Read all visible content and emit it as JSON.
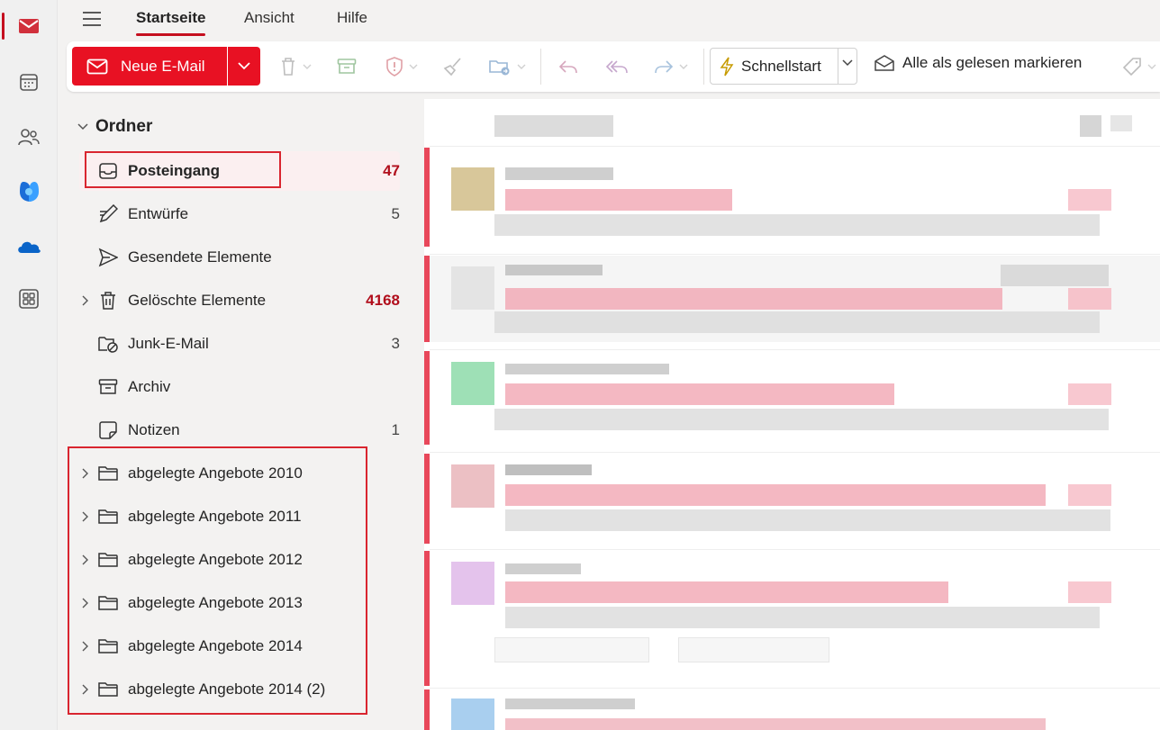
{
  "rail": {
    "items": [
      {
        "name": "mail-icon",
        "active": true
      },
      {
        "name": "calendar-icon",
        "active": false
      },
      {
        "name": "people-icon",
        "active": false
      },
      {
        "name": "copilot-icon",
        "active": false
      },
      {
        "name": "onedrive-icon",
        "active": false
      },
      {
        "name": "apps-icon",
        "active": false
      }
    ]
  },
  "menu": {
    "tabs": [
      "Startseite",
      "Ansicht",
      "Hilfe"
    ],
    "active_tab": "Startseite"
  },
  "ribbon": {
    "new_mail_label": "Neue E-Mail",
    "quick_start_label": "Schnellstart",
    "mark_read_label": "Alle als gelesen markieren"
  },
  "folders": {
    "header": "Ordner",
    "items": [
      {
        "label": "Posteingang",
        "count": "47",
        "icon": "inbox-icon"
      },
      {
        "label": "Entwürfe",
        "count": "5",
        "icon": "drafts-icon"
      },
      {
        "label": "Gesendete Elemente",
        "count": "",
        "icon": "sent-icon"
      },
      {
        "label": "Gelöschte Elemente",
        "count": "4168",
        "icon": "trash-icon"
      },
      {
        "label": "Junk-E-Mail",
        "count": "3",
        "icon": "junk-icon"
      },
      {
        "label": "Archiv",
        "count": "",
        "icon": "archive-icon"
      },
      {
        "label": "Notizen",
        "count": "1",
        "icon": "notes-icon"
      },
      {
        "label": "abgelegte Angebote 2010",
        "count": "",
        "icon": "folder-icon"
      },
      {
        "label": "abgelegte Angebote 2011",
        "count": "",
        "icon": "folder-icon"
      },
      {
        "label": "abgelegte Angebote 2012",
        "count": "",
        "icon": "folder-icon"
      },
      {
        "label": "abgelegte Angebote 2013",
        "count": "",
        "icon": "folder-icon"
      },
      {
        "label": "abgelegte Angebote 2014",
        "count": "",
        "icon": "folder-icon"
      },
      {
        "label": "abgelegte Angebote 2014 (2)",
        "count": "",
        "icon": "folder-icon"
      }
    ]
  },
  "colors": {
    "accent": "#c50f1f",
    "new_mail_bg": "#e81123",
    "unread_count": "#b10e1c",
    "selected_bg": "#fbeff0",
    "highlight_box": "#d9252f"
  }
}
